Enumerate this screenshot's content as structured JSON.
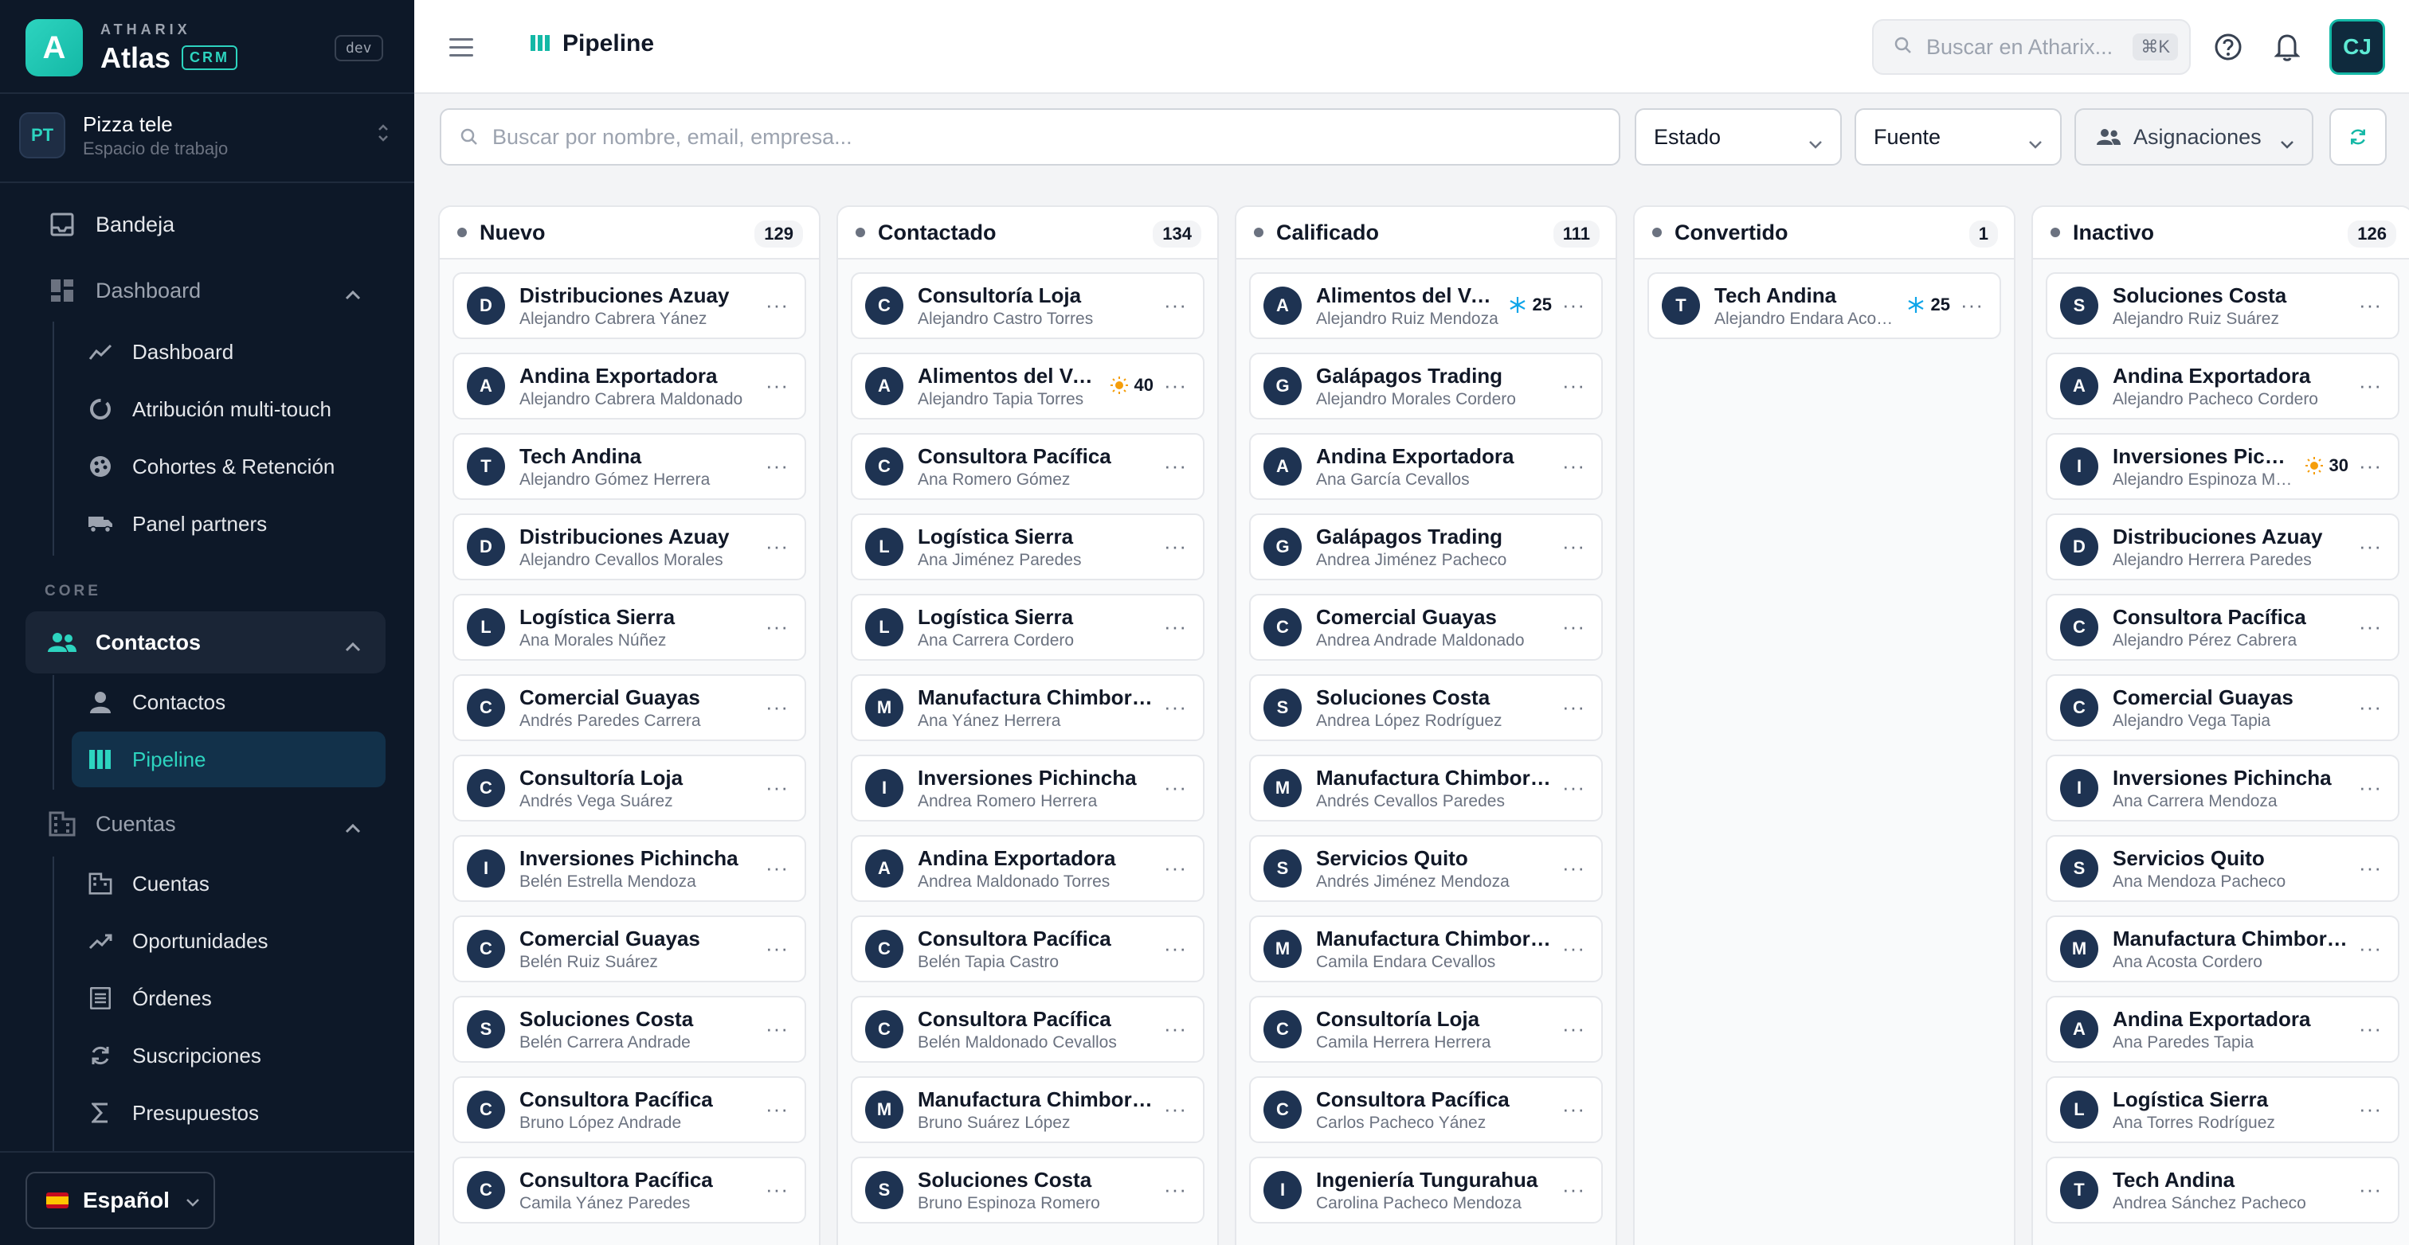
{
  "brand": {
    "small": "ATHARIX",
    "name": "Atlas",
    "badge": "CRM",
    "env": "dev",
    "logo_letter": "A"
  },
  "workspace": {
    "initials": "PT",
    "name": "Pizza tele",
    "subtitle": "Espacio de trabajo"
  },
  "sidebar": {
    "inbox": "Bandeja",
    "dashboard_group": "Dashboard",
    "dashboard_items": [
      "Dashboard",
      "Atribución multi-touch",
      "Cohortes & Retención",
      "Panel partners"
    ],
    "core_label": "CORE",
    "contacts_group": "Contactos",
    "contacts_items": [
      "Contactos",
      "Pipeline"
    ],
    "accounts_group": "Cuentas",
    "accounts_items": [
      "Cuentas",
      "Oportunidades",
      "Órdenes",
      "Suscripciones",
      "Presupuestos"
    ],
    "language": "Español"
  },
  "topbar": {
    "title": "Pipeline",
    "search_placeholder": "Buscar en Atharix...",
    "shortcut": "⌘K",
    "user_initials": "CJ"
  },
  "filters": {
    "search_placeholder": "Buscar por nombre, email, empresa...",
    "status": "Estado",
    "source": "Fuente",
    "assignments": "Asignaciones"
  },
  "colors": {
    "accent": "#2dd4bf",
    "sidebar_bg": "#0d1828",
    "avatar_bg": "#1e3352",
    "warm_score": "#f59e0b",
    "cold_score": "#0ea5e9"
  },
  "columns": [
    {
      "title": "Nuevo",
      "count": "129",
      "cards": [
        {
          "initial": "D",
          "title": "Distribuciones Azuay",
          "subtitle": "Alejandro Cabrera Yánez"
        },
        {
          "initial": "A",
          "title": "Andina Exportadora",
          "subtitle": "Alejandro Cabrera Maldonado"
        },
        {
          "initial": "T",
          "title": "Tech Andina",
          "subtitle": "Alejandro Gómez Herrera"
        },
        {
          "initial": "D",
          "title": "Distribuciones Azuay",
          "subtitle": "Alejandro Cevallos Morales"
        },
        {
          "initial": "L",
          "title": "Logística Sierra",
          "subtitle": "Ana Morales Núñez"
        },
        {
          "initial": "C",
          "title": "Comercial Guayas",
          "subtitle": "Andrés Paredes Carrera"
        },
        {
          "initial": "C",
          "title": "Consultoría Loja",
          "subtitle": "Andrés Vega Suárez"
        },
        {
          "initial": "I",
          "title": "Inversiones Pichincha",
          "subtitle": "Belén Estrella Mendoza"
        },
        {
          "initial": "C",
          "title": "Comercial Guayas",
          "subtitle": "Belén Ruiz Suárez"
        },
        {
          "initial": "S",
          "title": "Soluciones Costa",
          "subtitle": "Belén Carrera Andrade"
        },
        {
          "initial": "C",
          "title": "Consultora Pacífica",
          "subtitle": "Bruno López Andrade"
        },
        {
          "initial": "C",
          "title": "Consultora Pacífica",
          "subtitle": "Camila Yánez Paredes"
        }
      ]
    },
    {
      "title": "Contactado",
      "count": "134",
      "cards": [
        {
          "initial": "C",
          "title": "Consultoría Loja",
          "subtitle": "Alejandro Castro Torres"
        },
        {
          "initial": "A",
          "title": "Alimentos del Valle",
          "subtitle": "Alejandro Tapia Torres",
          "score": "40",
          "score_icon": "sun-icon"
        },
        {
          "initial": "C",
          "title": "Consultora Pacífica",
          "subtitle": "Ana Romero Gómez"
        },
        {
          "initial": "L",
          "title": "Logística Sierra",
          "subtitle": "Ana Jiménez Paredes"
        },
        {
          "initial": "L",
          "title": "Logística Sierra",
          "subtitle": "Ana Carrera Cordero"
        },
        {
          "initial": "M",
          "title": "Manufactura Chimborazo",
          "subtitle": "Ana Yánez Herrera"
        },
        {
          "initial": "I",
          "title": "Inversiones Pichincha",
          "subtitle": "Andrea Romero Herrera"
        },
        {
          "initial": "A",
          "title": "Andina Exportadora",
          "subtitle": "Andrea Maldonado Torres"
        },
        {
          "initial": "C",
          "title": "Consultora Pacífica",
          "subtitle": "Belén Tapia Castro"
        },
        {
          "initial": "C",
          "title": "Consultora Pacífica",
          "subtitle": "Belén Maldonado Cevallos"
        },
        {
          "initial": "M",
          "title": "Manufactura Chimborazo",
          "subtitle": "Bruno Suárez López"
        },
        {
          "initial": "S",
          "title": "Soluciones Costa",
          "subtitle": "Bruno Espinoza Romero"
        }
      ]
    },
    {
      "title": "Calificado",
      "count": "111",
      "cards": [
        {
          "initial": "A",
          "title": "Alimentos del Valle",
          "subtitle": "Alejandro Ruiz Mendoza",
          "score": "25",
          "score_icon": "snowflake-icon"
        },
        {
          "initial": "G",
          "title": "Galápagos Trading",
          "subtitle": "Alejandro Morales Cordero"
        },
        {
          "initial": "A",
          "title": "Andina Exportadora",
          "subtitle": "Ana García Cevallos"
        },
        {
          "initial": "G",
          "title": "Galápagos Trading",
          "subtitle": "Andrea Jiménez Pacheco"
        },
        {
          "initial": "C",
          "title": "Comercial Guayas",
          "subtitle": "Andrea Andrade Maldonado"
        },
        {
          "initial": "S",
          "title": "Soluciones Costa",
          "subtitle": "Andrea López Rodríguez"
        },
        {
          "initial": "M",
          "title": "Manufactura Chimborazo",
          "subtitle": "Andrés Cevallos Paredes"
        },
        {
          "initial": "S",
          "title": "Servicios Quito",
          "subtitle": "Andrés Jiménez Mendoza"
        },
        {
          "initial": "M",
          "title": "Manufactura Chimborazo",
          "subtitle": "Camila Endara Cevallos"
        },
        {
          "initial": "C",
          "title": "Consultoría Loja",
          "subtitle": "Camila Herrera Herrera"
        },
        {
          "initial": "C",
          "title": "Consultora Pacífica",
          "subtitle": "Carlos Pacheco Yánez"
        },
        {
          "initial": "I",
          "title": "Ingeniería Tungurahua",
          "subtitle": "Carolina Pacheco Mendoza"
        }
      ]
    },
    {
      "title": "Convertido",
      "count": "1",
      "cards": [
        {
          "initial": "T",
          "title": "Tech Andina",
          "subtitle": "Alejandro Endara Acosta",
          "score": "25",
          "score_icon": "snowflake-icon"
        }
      ]
    },
    {
      "title": "Inactivo",
      "count": "126",
      "cards": [
        {
          "initial": "S",
          "title": "Soluciones Costa",
          "subtitle": "Alejandro Ruiz Suárez"
        },
        {
          "initial": "A",
          "title": "Andina Exportadora",
          "subtitle": "Alejandro Pacheco Cordero"
        },
        {
          "initial": "I",
          "title": "Inversiones Pichincha",
          "subtitle": "Alejandro Espinoza Mendoza",
          "score": "30",
          "score_icon": "sun-icon"
        },
        {
          "initial": "D",
          "title": "Distribuciones Azuay",
          "subtitle": "Alejandro Herrera Paredes"
        },
        {
          "initial": "C",
          "title": "Consultora Pacífica",
          "subtitle": "Alejandro Pérez Cabrera"
        },
        {
          "initial": "C",
          "title": "Comercial Guayas",
          "subtitle": "Alejandro Vega Tapia"
        },
        {
          "initial": "I",
          "title": "Inversiones Pichincha",
          "subtitle": "Ana Carrera Mendoza"
        },
        {
          "initial": "S",
          "title": "Servicios Quito",
          "subtitle": "Ana Mendoza Pacheco"
        },
        {
          "initial": "M",
          "title": "Manufactura Chimborazo",
          "subtitle": "Ana Acosta Cordero"
        },
        {
          "initial": "A",
          "title": "Andina Exportadora",
          "subtitle": "Ana Paredes Tapia"
        },
        {
          "initial": "L",
          "title": "Logística Sierra",
          "subtitle": "Ana Torres Rodríguez"
        },
        {
          "initial": "T",
          "title": "Tech Andina",
          "subtitle": "Andrea Sánchez Pacheco"
        }
      ]
    }
  ]
}
